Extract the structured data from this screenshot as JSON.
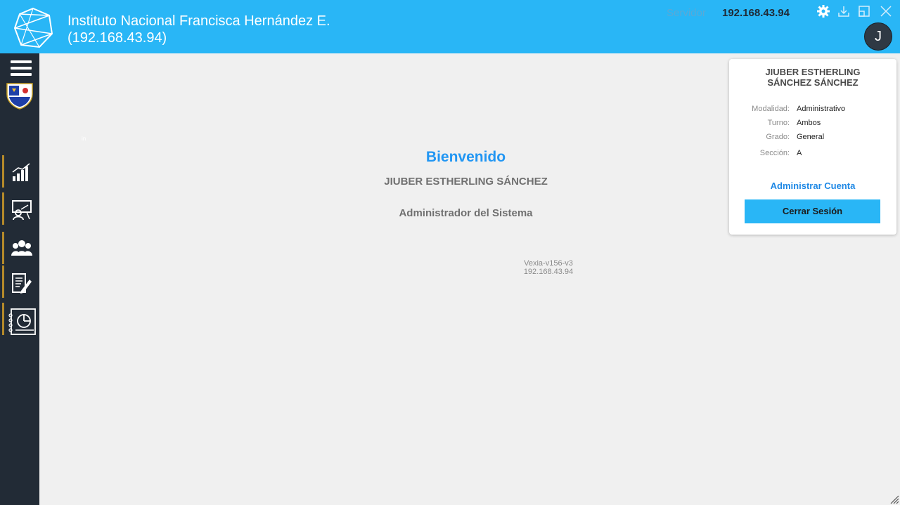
{
  "header": {
    "title_line1": "Instituto Nacional Francisca Hernández E.",
    "title_line2": "(192.168.43.94)",
    "server_label": "Servidor",
    "server_value": "192.168.43.94",
    "avatar_letter": "J"
  },
  "sidebar": {
    "items": [
      {
        "icon": "bar-chart-icon"
      },
      {
        "icon": "presentation-board-icon"
      },
      {
        "icon": "users-group-icon"
      },
      {
        "icon": "document-edit-icon"
      },
      {
        "icon": "notebook-pie-chart-icon"
      }
    ]
  },
  "main": {
    "tiny_label": "in",
    "welcome": "Bienvenido",
    "username": "JIUBER ESTHERLING SÁNCHEZ",
    "role": "Administrador del Sistema",
    "version_line1": "Vexia-v156-v3",
    "version_line2": "192.168.43.94"
  },
  "user_card": {
    "name_line1": "JIUBER ESTHERLING",
    "name_line2": "SÁNCHEZ SÁNCHEZ",
    "fields": [
      {
        "label": "Modalidad:",
        "value": "Administrativo"
      },
      {
        "label": "Turno:",
        "value": "Ambos"
      },
      {
        "label": "Grado:",
        "value": "General"
      },
      {
        "label": "Sección:",
        "value": "A"
      }
    ],
    "manage_label": "Administrar Cuenta",
    "logout_label": "Cerrar Sesión"
  },
  "colors": {
    "topbar": "#29b6f6",
    "sidebar": "#222b36",
    "accent_blue": "#2196f3",
    "nav_marker": "#b58a2a"
  }
}
